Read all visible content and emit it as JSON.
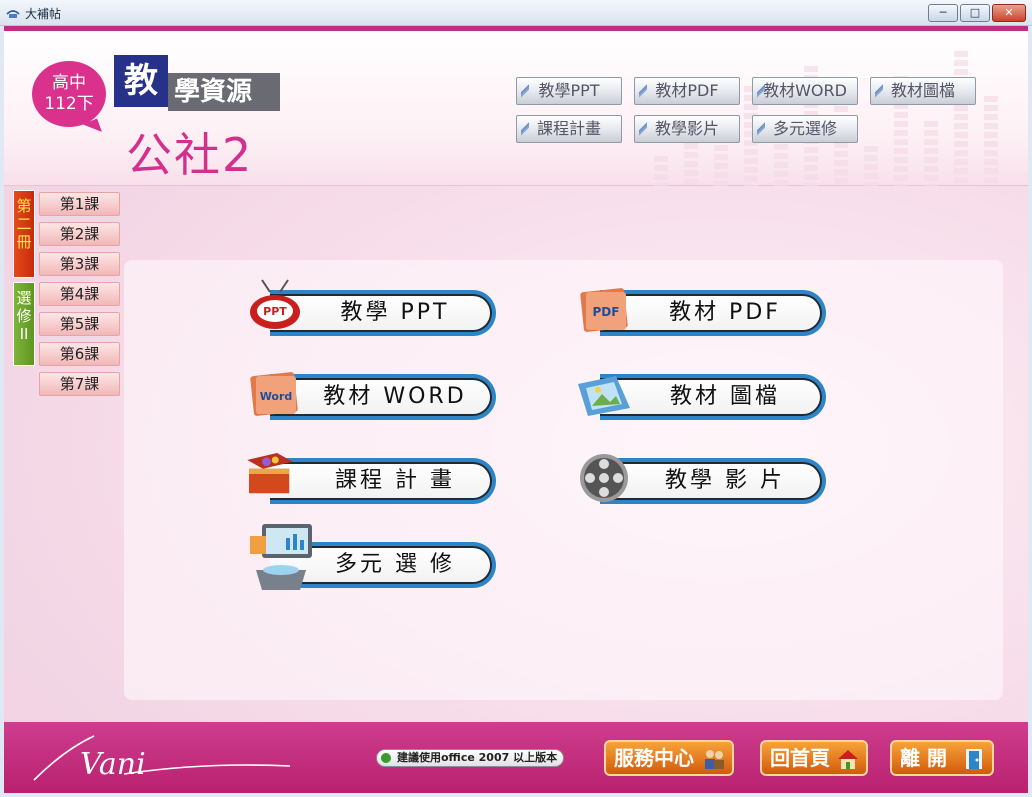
{
  "window": {
    "title": "大補帖",
    "min": "─",
    "max": "□",
    "close": "✕"
  },
  "header": {
    "grade_line1": "高中",
    "grade_line2": "112下",
    "logo_char": "教",
    "logo_rest": "學資源",
    "subject": "公社2",
    "nav": [
      "教學PPT",
      "教材PDF",
      "教材WORD",
      "教材圖檔",
      "課程計畫",
      "教學影片",
      "多元選修"
    ]
  },
  "sidebar": {
    "volumes": [
      "第二冊",
      "選修II"
    ],
    "lessons": [
      "第1課",
      "第2課",
      "第3課",
      "第4課",
      "第5課",
      "第6課",
      "第7課"
    ]
  },
  "resources": [
    {
      "label": "教學 PPT",
      "icon": "ppt-tv-icon"
    },
    {
      "label": "教材 PDF",
      "icon": "pdf-folder-icon"
    },
    {
      "label": "教材 WORD",
      "icon": "word-folder-icon"
    },
    {
      "label": "教材 圖檔",
      "icon": "image-folder-icon"
    },
    {
      "label": "課程 計 畫",
      "icon": "treasure-chest-icon"
    },
    {
      "label": "教學 影 片",
      "icon": "film-reel-icon"
    },
    {
      "label": "多元 選 修",
      "icon": "presentation-screen-icon"
    }
  ],
  "footer": {
    "brand": "Vani",
    "office_note": "建議使用office 2007 以上版本",
    "service": "服務中心",
    "home": "回首頁",
    "exit": "離 開"
  },
  "colors": {
    "accent": "#c42b84",
    "blue": "#2c85c8",
    "orange": "#e0701c"
  }
}
